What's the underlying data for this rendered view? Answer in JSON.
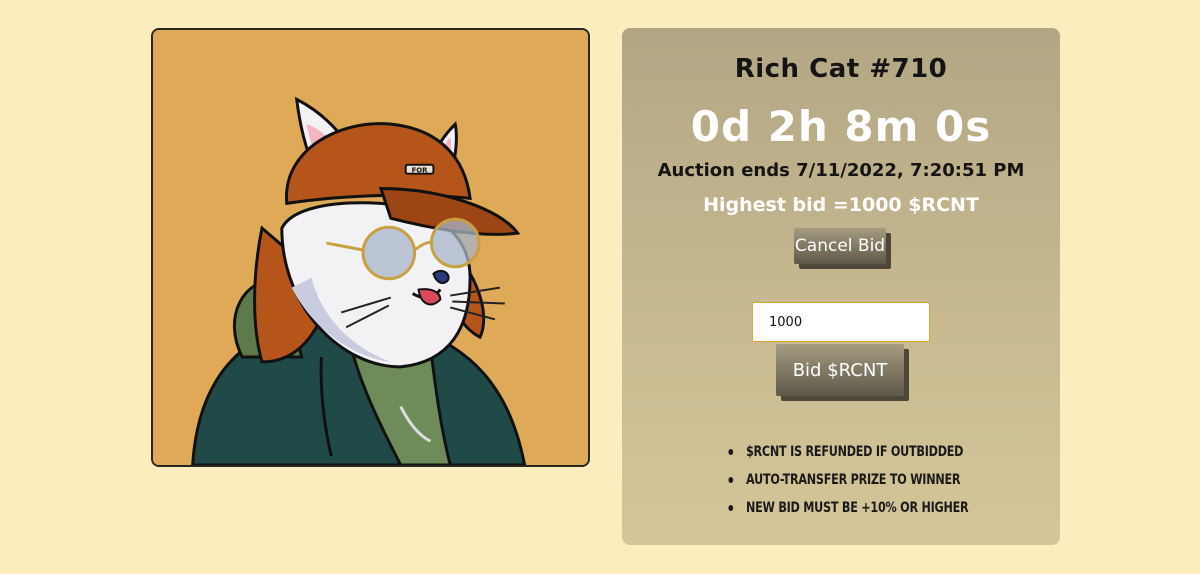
{
  "artwork": {
    "alt": "Rich Cat #710 artwork",
    "icon": "cat-avatar-illustration",
    "background_color": "#dfaa58",
    "cap_text": "FOR"
  },
  "auction": {
    "title": "Rich Cat #710",
    "countdown": "0d 2h 8m 0s",
    "ends_text": "Auction ends 7/11/2022, 7:20:51 PM",
    "highest_bid_text": "Highest bid =1000 $RCNT"
  },
  "actions": {
    "cancel_bid_label": "Cancel Bid",
    "bid_input_value": "1000",
    "bid_button_label": "Bid $RCNT"
  },
  "rules": [
    "$RCNT is refunded if outbidded",
    "Auto-transfer prize to winner",
    "New bid must be +10% or higher"
  ],
  "colors": {
    "page_background": "#fbedbd",
    "panel_top": "#b3a684",
    "panel_bottom": "#d5c699",
    "countdown_text": "#ffffff",
    "input_border": "#e0a82e"
  }
}
